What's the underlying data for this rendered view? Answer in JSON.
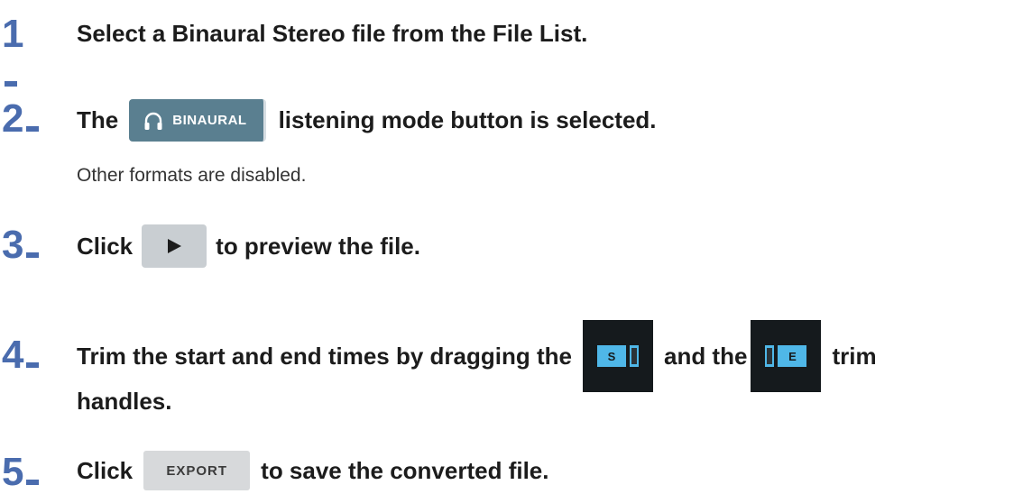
{
  "steps": [
    {
      "number": "1",
      "text": "Select a Binaural Stereo file from the File List."
    },
    {
      "number": "2",
      "text_before": "The",
      "button_label": "BINAURAL",
      "button_icon": "headphones-icon",
      "text_after": "listening mode button is selected.",
      "note": "Other formats are disabled."
    },
    {
      "number": "3",
      "text_before": "Click",
      "button_icon": "play-icon",
      "text_after": "to preview the file."
    },
    {
      "number": "4",
      "text_before": "Trim the start and end times by dragging the",
      "start_handle_label": "S",
      "text_middle": "and the",
      "end_handle_label": "E",
      "text_after": "trim",
      "text_line2": "handles."
    },
    {
      "number": "5",
      "text_before": "Click",
      "button_label": "EXPORT",
      "text_after": "to save the converted file."
    }
  ],
  "colors": {
    "step_number": "#4a6cae",
    "binaural_button": "#5a7f90",
    "trim_handle": "#4fb7e8",
    "trim_background": "#151a1d"
  }
}
